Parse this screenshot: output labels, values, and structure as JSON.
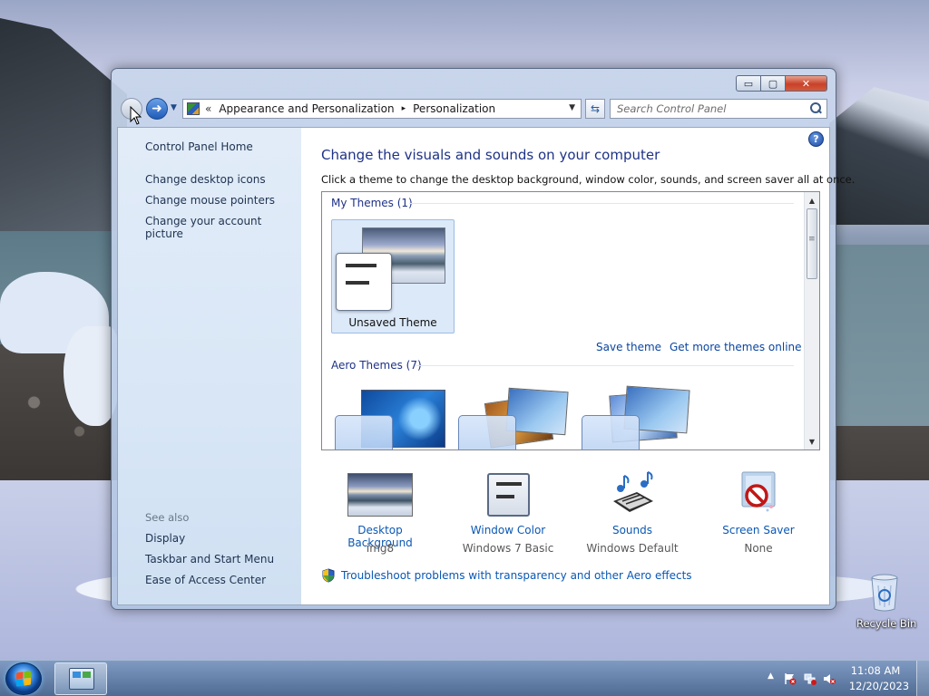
{
  "window": {
    "breadcrumb": {
      "overflow": "«",
      "segments": [
        "Appearance and Personalization",
        "Personalization"
      ],
      "separator": "▸"
    },
    "search": {
      "placeholder": "Search Control Panel"
    },
    "caption_buttons": {
      "minimize": "▭",
      "maximize": "▢",
      "close": "✕"
    }
  },
  "sidebar": {
    "home": "Control Panel Home",
    "links": [
      "Change desktop icons",
      "Change mouse pointers",
      "Change your account picture"
    ],
    "see_also_title": "See also",
    "see_also_links": [
      "Display",
      "Taskbar and Start Menu",
      "Ease of Access Center"
    ]
  },
  "main": {
    "heading": "Change the visuals and sounds on your computer",
    "subheading": "Click a theme to change the desktop background, window color, sounds, and screen saver all at once.",
    "my_themes": {
      "title": "My Themes (1)",
      "selected_theme": "Unsaved Theme",
      "save_theme": "Save theme",
      "get_more": "Get more themes online"
    },
    "aero_themes": {
      "title": "Aero Themes (7)"
    },
    "customize": [
      {
        "title": "Desktop Background",
        "value": "img8",
        "icon": "desktop-background-icon"
      },
      {
        "title": "Window Color",
        "value": "Windows 7 Basic",
        "icon": "window-color-icon"
      },
      {
        "title": "Sounds",
        "value": "Windows Default",
        "icon": "sounds-icon"
      },
      {
        "title": "Screen Saver",
        "value": "None",
        "icon": "screen-saver-icon"
      }
    ],
    "troubleshoot": "Troubleshoot problems with transparency and other Aero effects"
  },
  "desktop": {
    "recycle_bin": "Recycle Bin"
  },
  "taskbar": {
    "time": "11:08 AM",
    "date": "12/20/2023"
  },
  "colors": {
    "link_blue": "#0a58b4",
    "heading_blue": "#1e3287",
    "sidebar_bg": "#dbe8f7",
    "selection_bg": "#dce9f8"
  }
}
